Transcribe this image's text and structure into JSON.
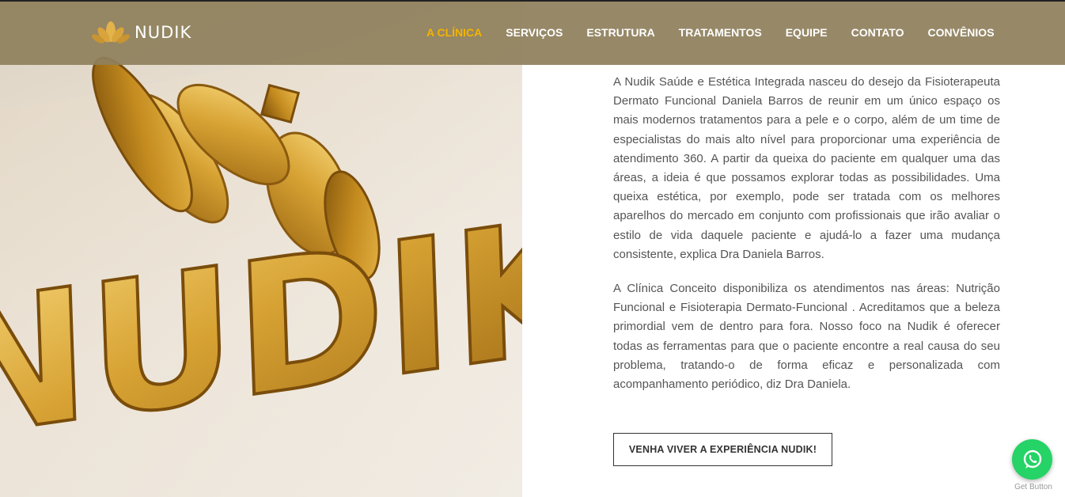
{
  "brand": {
    "name": "NUDIK"
  },
  "nav": {
    "items": [
      {
        "label": "A CLÍNICA",
        "active": true
      },
      {
        "label": "SERVIÇOS",
        "active": false
      },
      {
        "label": "ESTRUTURA",
        "active": false
      },
      {
        "label": "TRATAMENTOS",
        "active": false
      },
      {
        "label": "EQUIPE",
        "active": false
      },
      {
        "label": "CONTATO",
        "active": false
      },
      {
        "label": "CONVÊNIOS",
        "active": false
      }
    ]
  },
  "hero": {
    "sign_text": "NUDIK"
  },
  "content": {
    "paragraphs": [
      "A Nudik Saúde e Estética Integrada nasceu do desejo da Fisioterapeuta Dermato Funcional Daniela Barros de reunir em um único espaço os mais modernos tratamentos para a pele e o corpo, além de um time de especialistas do mais alto nível para proporcionar uma experiência de atendimento 360. A partir da queixa do paciente em qualquer uma das áreas, a ideia é que possamos explorar todas as possibilidades. Uma queixa estética, por exemplo, pode ser tratada com os melhores aparelhos do mercado em conjunto com profissionais que irão avaliar o estilo de vida daquele paciente e ajudá-lo a fazer uma mudança consistente, explica Dra Daniela Barros.",
      "A Clínica Conceito disponibiliza os atendimentos nas áreas: Nutrição Funcional e Fisioterapia Dermato-Funcional . Acreditamos que a beleza primordial vem de dentro para fora. Nosso foco na Nudik é oferecer todas as ferramentas para que o paciente encontre a real causa do seu problema, tratando-o de forma eficaz e personalizada com acompanhamento periódico, diz Dra Daniela."
    ]
  },
  "cta": {
    "label": "VENHA VIVER A EXPERIÊNCIA NUDIK!"
  },
  "whatsapp": {
    "label": "Get Button",
    "icon": "whatsapp-icon"
  },
  "colors": {
    "header_bg": "#8f805c",
    "nav_active": "#f3b400",
    "gold": "#c8901e",
    "whatsapp": "#25d366"
  }
}
